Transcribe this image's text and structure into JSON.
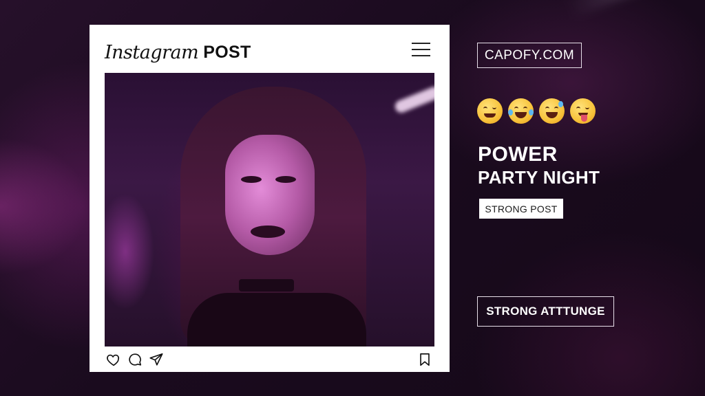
{
  "post_card": {
    "brand": "Instagram",
    "title_suffix": "POST",
    "icons": {
      "menu": "hamburger-menu-icon",
      "like": "heart-icon",
      "comment": "comment-bubble-icon",
      "share": "send-arrow-icon",
      "save": "bookmark-icon"
    }
  },
  "sidebar": {
    "website": "CAPOFY.COM",
    "emojis": [
      "winking-face",
      "rolling-on-floor-laughing",
      "grinning-face-with-sweat",
      "face-with-tongue-winking"
    ],
    "headline_line1": "POWER",
    "headline_line2": "PARTY NIGHT",
    "tag_label": "STRONG POST",
    "cta_label": "STRONG ATTTUNGE"
  },
  "colors": {
    "background": "#1a0a1c",
    "card": "#ffffff",
    "accent_neon": "#d24fd0",
    "text_light": "#ffffff",
    "text_dark": "#111111"
  }
}
